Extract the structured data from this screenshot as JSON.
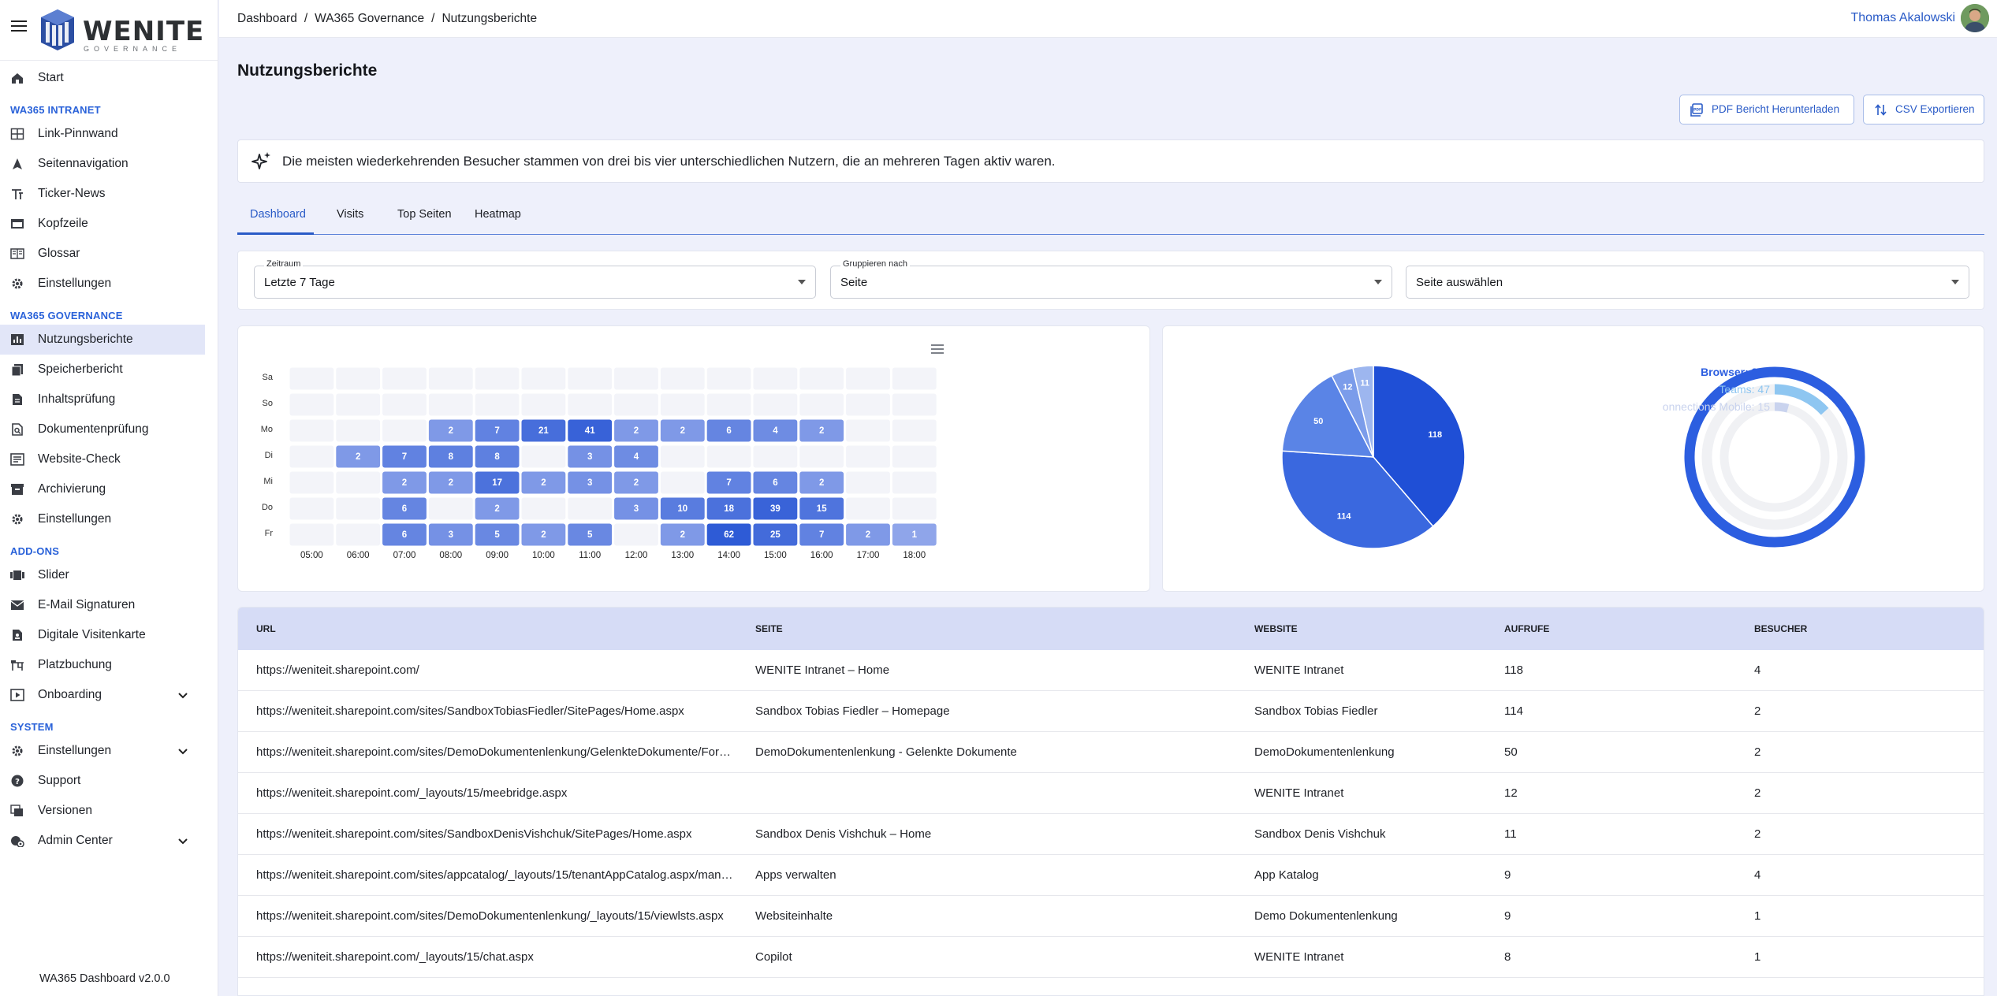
{
  "app": {
    "logo_text": "WENITE",
    "logo_sub": "GOVERNANCE",
    "version": "WA365 Dashboard v2.0.0"
  },
  "sidebar": {
    "sections": [
      {
        "items": [
          {
            "label": "Start",
            "icon": "home-icon"
          }
        ]
      },
      {
        "title": "WA365 INTRANET",
        "items": [
          {
            "label": "Link-Pinnwand",
            "icon": "grid-icon"
          },
          {
            "label": "Seitennavigation",
            "icon": "navigation-arrow-icon"
          },
          {
            "label": "Ticker-News",
            "icon": "ticker-icon"
          },
          {
            "label": "Kopfzeile",
            "icon": "header-icon"
          },
          {
            "label": "Glossar",
            "icon": "book-icon"
          },
          {
            "label": "Einstellungen",
            "icon": "gear-icon"
          }
        ]
      },
      {
        "title": "WA365 GOVERNANCE",
        "items": [
          {
            "label": "Nutzungsberichte",
            "icon": "bar-chart-icon",
            "active": true
          },
          {
            "label": "Speicherbericht",
            "icon": "document-copy-icon"
          },
          {
            "label": "Inhaltsprüfung",
            "icon": "document-icon"
          },
          {
            "label": "Dokumentenprüfung",
            "icon": "document-search-icon"
          },
          {
            "label": "Website-Check",
            "icon": "checklist-icon"
          },
          {
            "label": "Archivierung",
            "icon": "archive-icon"
          },
          {
            "label": "Einstellungen",
            "icon": "gear-icon"
          }
        ]
      },
      {
        "title": "ADD-ONS",
        "items": [
          {
            "label": "Slider",
            "icon": "slider-icon"
          },
          {
            "label": "E-Mail Signaturen",
            "icon": "mail-icon"
          },
          {
            "label": "Digitale Visitenkarte",
            "icon": "badge-icon"
          },
          {
            "label": "Platzbuchung",
            "icon": "desk-icon"
          },
          {
            "label": "Onboarding",
            "icon": "play-icon",
            "expandable": true
          }
        ]
      },
      {
        "title": "SYSTEM",
        "items": [
          {
            "label": "Einstellungen",
            "icon": "gear-icon",
            "expandable": true
          },
          {
            "label": "Support",
            "icon": "help-icon"
          },
          {
            "label": "Versionen",
            "icon": "versions-icon"
          },
          {
            "label": "Admin Center",
            "icon": "admin-icon",
            "expandable": true
          }
        ]
      }
    ]
  },
  "header": {
    "breadcrumb": [
      "Dashboard",
      "WA365 Governance",
      "Nutzungsberichte"
    ],
    "user_name": "Thomas Akalowski"
  },
  "page": {
    "title": "Nutzungsberichte",
    "pdf_button": "PDF Bericht Herunterladen",
    "csv_button": "CSV Exportieren",
    "insight": "Die meisten wiederkehrenden Besucher stammen von drei bis vier unterschiedlichen Nutzern, die an mehreren Tagen aktiv waren."
  },
  "tabs": [
    "Dashboard",
    "Visits",
    "Top Seiten",
    "Heatmap"
  ],
  "filters": {
    "zeitraum": {
      "label": "Zeitraum",
      "value": "Letzte 7 Tage"
    },
    "gruppieren": {
      "label": "Gruppieren nach",
      "value": "Seite"
    },
    "seite": {
      "value": "Seite auswählen"
    }
  },
  "chart_data": [
    {
      "type": "heatmap",
      "y_categories": [
        "Sa",
        "So",
        "Mo",
        "Di",
        "Mi",
        "Do",
        "Fr"
      ],
      "x_categories": [
        "05:00",
        "06:00",
        "07:00",
        "08:00",
        "09:00",
        "10:00",
        "11:00",
        "12:00",
        "13:00",
        "14:00",
        "15:00",
        "16:00",
        "17:00",
        "18:00"
      ],
      "values": [
        [
          null,
          null,
          null,
          null,
          null,
          null,
          null,
          null,
          null,
          null,
          null,
          null,
          null,
          null
        ],
        [
          null,
          null,
          null,
          null,
          null,
          null,
          null,
          null,
          null,
          null,
          null,
          null,
          null,
          null
        ],
        [
          null,
          null,
          null,
          2,
          7,
          21,
          41,
          2,
          2,
          6,
          4,
          2,
          null,
          null
        ],
        [
          null,
          2,
          7,
          8,
          8,
          null,
          3,
          4,
          null,
          null,
          null,
          null,
          null,
          null
        ],
        [
          null,
          null,
          2,
          2,
          17,
          2,
          3,
          2,
          null,
          7,
          6,
          2,
          null,
          null
        ],
        [
          null,
          null,
          6,
          null,
          2,
          null,
          null,
          3,
          10,
          18,
          39,
          15,
          null,
          null
        ],
        [
          null,
          null,
          6,
          3,
          5,
          2,
          5,
          null,
          2,
          62,
          25,
          7,
          2,
          1
        ]
      ],
      "colors": {
        "empty": "#f3f4f9",
        "low": "#8fa5ea",
        "high": "#2e5bd6"
      }
    },
    {
      "type": "pie",
      "slices": [
        {
          "value": 118,
          "color": "#1f4fd6"
        },
        {
          "value": 114,
          "color": "#3a68df"
        },
        {
          "value": 50,
          "color": "#5a84e6"
        },
        {
          "value": 12,
          "color": "#7b9cea"
        },
        {
          "value": 11,
          "color": "#9db6ef"
        }
      ]
    },
    {
      "type": "radial-bar",
      "max": 355,
      "series": [
        {
          "name": "Browser",
          "value": 355,
          "color": "#2c5ee0",
          "label": "Browser: 355"
        },
        {
          "name": "Teams",
          "value": 47,
          "color": "#8ec6f1",
          "label": "Teams: 47"
        },
        {
          "name": "onnections Mobile",
          "value": 15,
          "color": "#c9d3ee",
          "label": "onnections Mobile: 15"
        }
      ]
    }
  ],
  "table": {
    "columns": [
      "URL",
      "SEITE",
      "WEBSITE",
      "AUFRUFE",
      "BESUCHER"
    ],
    "rows": [
      [
        "https://weniteit.sharepoint.com/",
        "WENITE Intranet – Home",
        "WENITE Intranet",
        "118",
        "4"
      ],
      [
        "https://weniteit.sharepoint.com/sites/SandboxTobiasFiedler/SitePages/Home.aspx",
        "Sandbox Tobias Fiedler – Homepage",
        "Sandbox Tobias Fiedler",
        "114",
        "2"
      ],
      [
        "https://weniteit.sharepoint.com/sites/DemoDokumentenlenkung/GelenkteDokumente/Forms/AllItems.aspx",
        "DemoDokumentenlenkung - Gelenkte Dokumente",
        "DemoDokumentenlenkung",
        "50",
        "2"
      ],
      [
        "https://weniteit.sharepoint.com/_layouts/15/meebridge.aspx",
        "",
        "WENITE Intranet",
        "12",
        "2"
      ],
      [
        "https://weniteit.sharepoint.com/sites/SandboxDenisVishchuk/SitePages/Home.aspx",
        "Sandbox Denis Vishchuk – Home",
        "Sandbox Denis Vishchuk",
        "11",
        "2"
      ],
      [
        "https://weniteit.sharepoint.com/sites/appcatalog/_layouts/15/tenantAppCatalog.aspx/manageApps",
        "Apps verwalten",
        "App Katalog",
        "9",
        "4"
      ],
      [
        "https://weniteit.sharepoint.com/sites/DemoDokumentenlenkung/_layouts/15/viewlsts.aspx",
        "Websiteinhalte",
        "Demo Dokumentenlenkung",
        "9",
        "1"
      ],
      [
        "https://weniteit.sharepoint.com/_layouts/15/chat.aspx",
        "Copilot",
        "WENITE Intranet",
        "8",
        "1"
      ]
    ]
  }
}
